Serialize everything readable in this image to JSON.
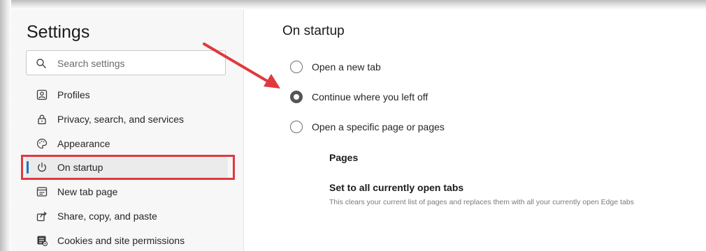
{
  "sidebar": {
    "title": "Settings",
    "search": {
      "placeholder": "Search settings",
      "value": ""
    },
    "items": [
      {
        "label": "Profiles",
        "icon": "profile-icon"
      },
      {
        "label": "Privacy, search, and services",
        "icon": "lock-icon"
      },
      {
        "label": "Appearance",
        "icon": "appearance-icon"
      },
      {
        "label": "On startup",
        "icon": "power-icon",
        "active": true
      },
      {
        "label": "New tab page",
        "icon": "new-tab-icon"
      },
      {
        "label": "Share, copy, and paste",
        "icon": "share-icon"
      },
      {
        "label": "Cookies and site permissions",
        "icon": "cookies-icon"
      }
    ]
  },
  "main": {
    "section_title": "On startup",
    "options": [
      {
        "label": "Open a new tab",
        "checked": false
      },
      {
        "label": "Continue where you left off",
        "checked": true
      },
      {
        "label": "Open a specific page or pages",
        "checked": false
      }
    ],
    "pages_label": "Pages",
    "set_tabs": {
      "title": "Set to all currently open tabs",
      "description": "This clears your current list of pages and replaces them with all your currently open Edge tabs"
    }
  },
  "colors": {
    "annotation_red": "#e0393e",
    "active_accent": "#1a73c8",
    "sidebar_bg": "#f7f7f7"
  }
}
